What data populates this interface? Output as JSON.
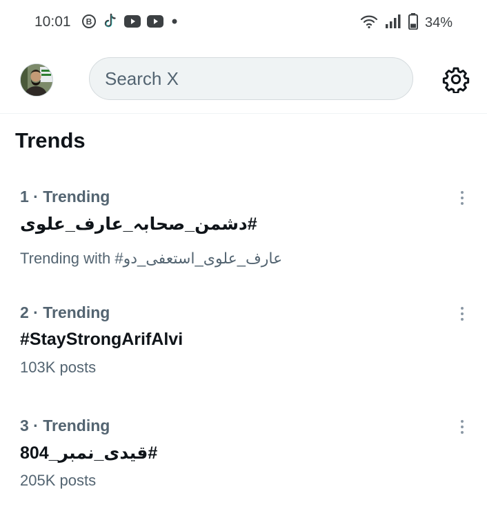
{
  "status_bar": {
    "time": "10:01",
    "battery": "34%",
    "left_icons": [
      "b-badge-icon",
      "tiktok-icon",
      "youtube-icon",
      "youtube-icon",
      "dot-icon"
    ],
    "right_icons": [
      "wifi-icon",
      "signal-icon",
      "battery-icon"
    ]
  },
  "header": {
    "search_placeholder": "Search X",
    "settings_icon": "gear-icon"
  },
  "trends": {
    "title": "Trends",
    "items": [
      {
        "meta": "1 · Trending",
        "name": "#دشمن_صحابہ_عارف_علوی",
        "sub": "Trending with #عارف_علوی_استعفی_دو"
      },
      {
        "meta": "2 · Trending",
        "name": "#StayStrongArifAlvi",
        "sub": "103K posts"
      },
      {
        "meta": "3 · Trending",
        "name": "#قیدی_نمبر_804",
        "sub": "205K posts"
      }
    ]
  },
  "colors": {
    "text_primary": "#0f1419",
    "text_secondary": "#536471",
    "search_bg": "#eff3f4"
  }
}
